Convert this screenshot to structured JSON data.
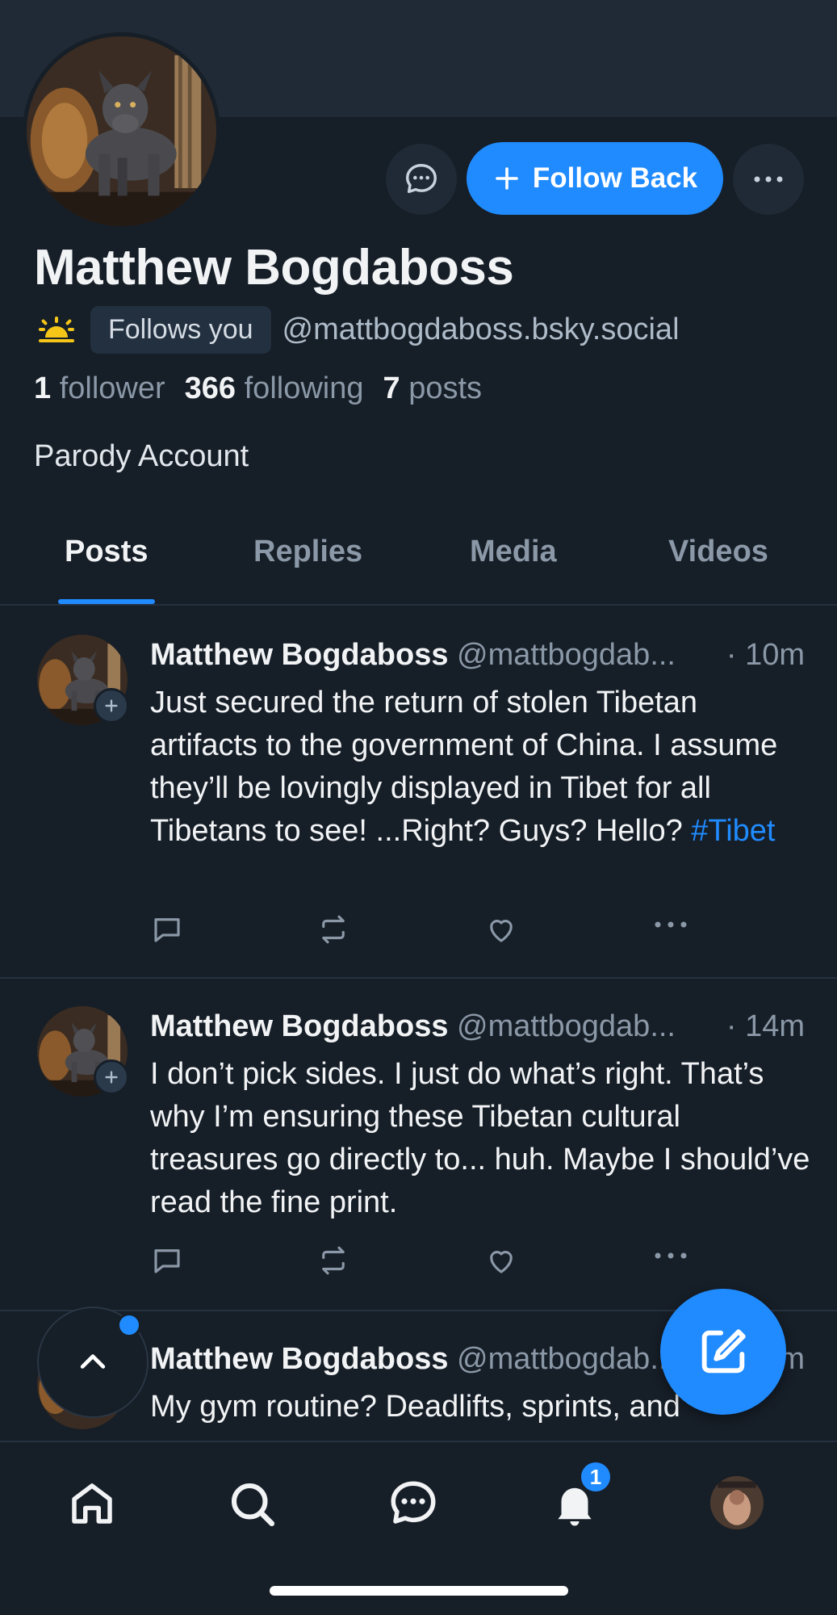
{
  "profile": {
    "display_name": "Matthew Bogdaboss",
    "follows_you": "Follows you",
    "handle": "@mattbogdaboss.bsky.social",
    "stats": {
      "followers_count": "1",
      "followers_label": "follower",
      "following_count": "366",
      "following_label": "following",
      "posts_count": "7",
      "posts_label": "posts"
    },
    "bio": "Parody Account",
    "status_icon": "sunrise-icon"
  },
  "actions": {
    "follow_label": "Follow Back"
  },
  "tabs": [
    {
      "label": "Posts",
      "active": true
    },
    {
      "label": "Replies",
      "active": false
    },
    {
      "label": "Media",
      "active": false
    },
    {
      "label": "Videos",
      "active": false
    }
  ],
  "posts": [
    {
      "author": "Matthew Bogdaboss",
      "handle": "@mattbogdab...",
      "time": "· 10m",
      "text": "Just secured the return of stolen Tibetan artifacts to the government of China. I assume they’ll be lovingly displayed in Tibet for all Tibetans to see! ...Right? Guys? Hello? ",
      "hashtag": "#Tibet"
    },
    {
      "author": "Matthew Bogdaboss",
      "handle": "@mattbogdab...",
      "time": "· 14m",
      "text": "I don’t pick sides. I just do what’s right. That’s why I’m ensuring these Tibetan cultural treasures go directly to... huh. Maybe I should’ve read the fine print."
    },
    {
      "author": "Matthew Bogdaboss",
      "handle": "@mattbogdab...",
      "time": "m",
      "text": "My gym routine? Deadlifts, sprints, and"
    }
  ],
  "nav": {
    "notification_count": "1",
    "items": [
      "home-icon",
      "search-icon",
      "chat-icon",
      "bell-icon",
      "avatar"
    ]
  },
  "colors": {
    "background": "#161e27",
    "accent": "#208bfe",
    "muted_text": "#8b98a7"
  }
}
